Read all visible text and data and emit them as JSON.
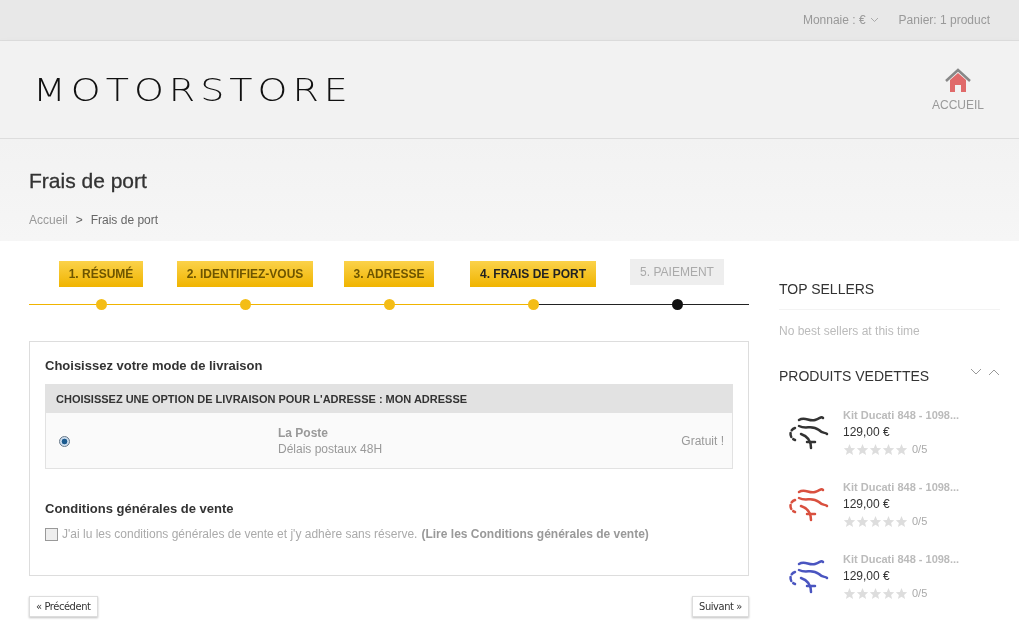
{
  "top_bar": {
    "currency": "Monnaie : €",
    "cart": "Panier: 1 product"
  },
  "header": {
    "logo": "MOTORSTORE",
    "home_link": "ACCUEIL"
  },
  "page": {
    "title": "Frais de port",
    "breadcrumb": [
      "Accueil",
      ">",
      "Frais de port"
    ]
  },
  "steps": [
    {
      "label": "1. RÉSUMÉ",
      "kind": "done"
    },
    {
      "label": "2. IDENTIFIEZ-VOUS",
      "kind": "done"
    },
    {
      "label": "3. ADRESSE",
      "kind": "done"
    },
    {
      "label": "4. FRAIS DE PORT",
      "kind": "current"
    },
    {
      "label": "5. PAIEMENT",
      "kind": "todo"
    }
  ],
  "delivery": {
    "heading": "Choisissez votre mode de livraison",
    "table_header": "CHOISISSEZ UNE OPTION DE LIVRAISON POUR L'ADRESSE : MON ADRESSE",
    "options": [
      {
        "selected": true,
        "carrier": "La Poste",
        "delay": "Délais postaux 48H",
        "price": "Gratuit !"
      }
    ]
  },
  "terms": {
    "heading": "Conditions générales de vente",
    "checked": false,
    "text": "J'ai lu les conditions générales de vente et j'y adhère sans réserve.",
    "link": "(Lire les Conditions générales de vente)"
  },
  "nav_buttons": {
    "previous": "« Précédent",
    "next": "Suivant »"
  },
  "sidebar": {
    "top_sellers": {
      "title": "TOP SELLERS",
      "empty": "No best sellers at this time"
    },
    "featured": {
      "title": "PRODUITS VEDETTES",
      "products": [
        {
          "name": "Kit Ducati 848 - 1098...",
          "price": "129,00 €",
          "stars": 0,
          "rating": "0/5",
          "color": "#333333"
        },
        {
          "name": "Kit Ducati 848 - 1098...",
          "price": "129,00 €",
          "stars": 0,
          "rating": "0/5",
          "color": "#d9503f"
        },
        {
          "name": "Kit Ducati 848 - 1098...",
          "price": "129,00 €",
          "stars": 0,
          "rating": "0/5",
          "color": "#4a55c0"
        }
      ]
    }
  }
}
